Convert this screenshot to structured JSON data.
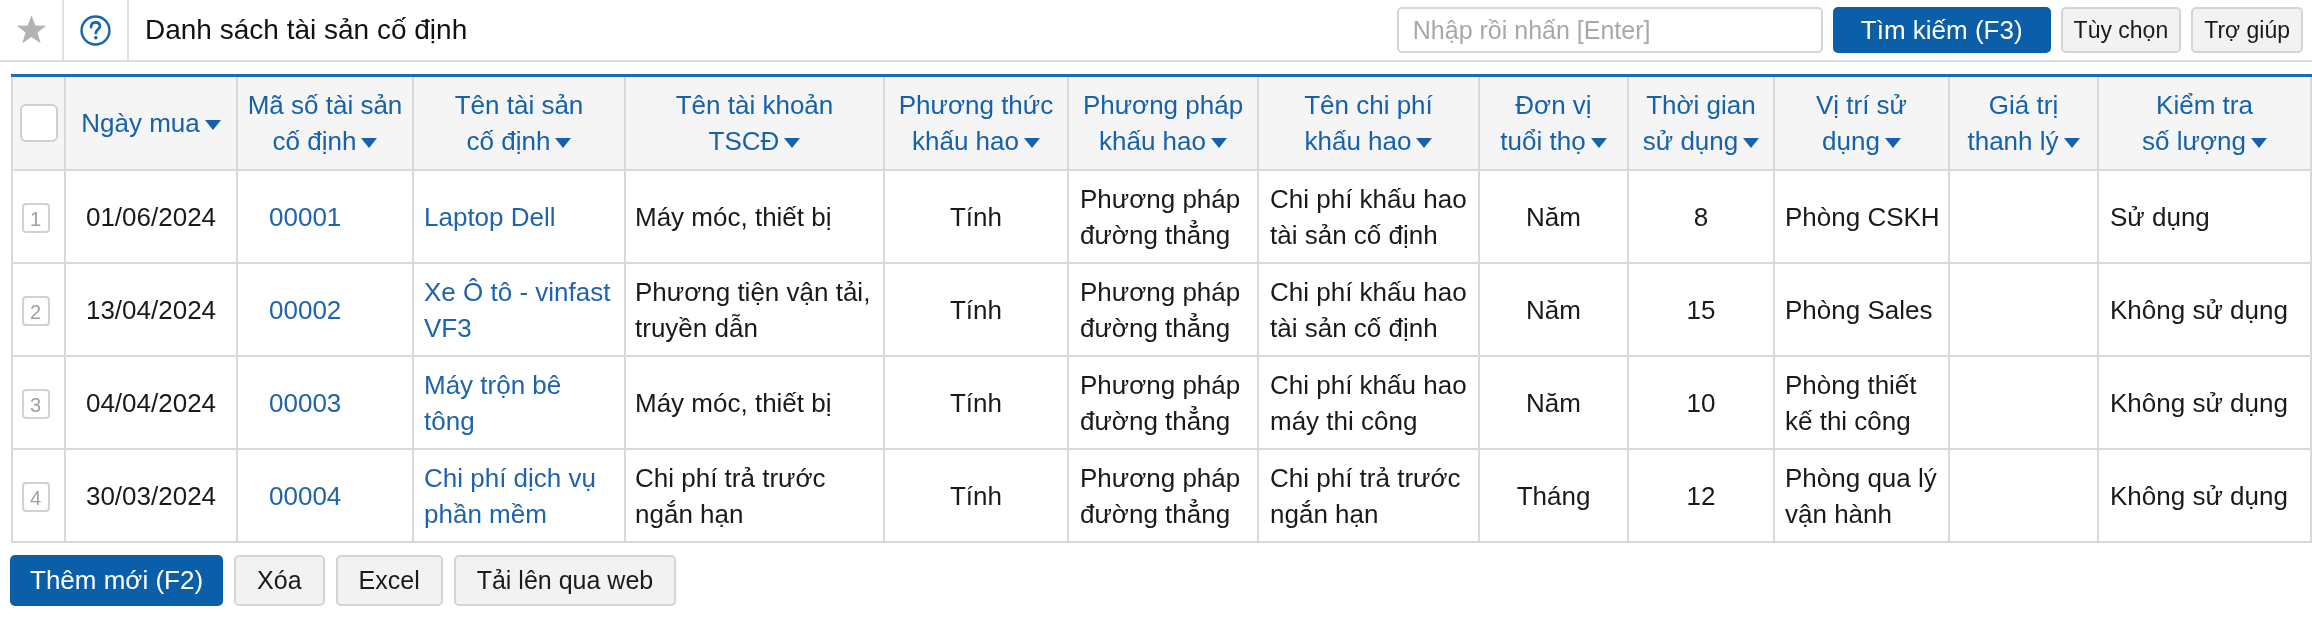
{
  "header": {
    "favorite": false,
    "title": "Danh sách tài sản cố định",
    "search": {
      "placeholder": "Nhập rồi nhấn [Enter]"
    },
    "buttons": [
      {
        "label": "Tìm kiếm (F3)",
        "kind": "primary"
      },
      {
        "label": "Tùy chọn",
        "kind": "secondary"
      },
      {
        "label": "Trợ giúp",
        "kind": "secondary"
      }
    ]
  },
  "table": {
    "select_all": {
      "checked": false
    },
    "columns": [
      {
        "label": "Ngày mua",
        "kind": "date"
      },
      {
        "label": "Mã số tài sản cố định",
        "kind": "code"
      },
      {
        "label": "Tên tài sản cố định",
        "kind": "link"
      },
      {
        "label": "Tên tài khoản TSCĐ",
        "kind": "text"
      },
      {
        "label": "Phương thức khấu hao",
        "kind": "center"
      },
      {
        "label": "Phương pháp khấu hao",
        "kind": "text"
      },
      {
        "label": "Tên chi phí khấu hao",
        "kind": "text"
      },
      {
        "label": "Đơn vị tuổi thọ",
        "kind": "center"
      },
      {
        "label": "Thời gian sử dụng",
        "kind": "center"
      },
      {
        "label": "Vị trí sử dụng",
        "kind": "text"
      },
      {
        "label": "Giá trị thanh lý"
      },
      {
        "label": "Kiểm tra số lượng",
        "kind": "text"
      }
    ],
    "rows": [
      {
        "number": "1",
        "cells": [
          "01/06/2024",
          "00001",
          "Laptop Dell",
          "Máy móc, thiết bị",
          "Tính",
          "Phương pháp đường thẳng",
          "Chi phí khấu hao tài sản cố định",
          "Năm",
          "8",
          "Phòng CSKH",
          null,
          "Sử dụng"
        ]
      },
      {
        "number": "2",
        "cells": [
          "13/04/2024",
          "00002",
          "Xe Ô tô - vinfast VF3",
          "Phương tiện vận tải, truyền dẫn",
          "Tính",
          "Phương pháp đường thẳng",
          "Chi phí khấu hao tài sản cố định",
          "Năm",
          "15",
          "Phòng Sales",
          null,
          "Không sử dụng"
        ]
      },
      {
        "number": "3",
        "cells": [
          "04/04/2024",
          "00003",
          "Máy trộn bê tông",
          "Máy móc, thiết bị",
          "Tính",
          "Phương pháp đường thẳng",
          "Chi phí khấu hao máy thi công",
          "Năm",
          "10",
          "Phòng thiết kế thi công",
          null,
          "Không sử dụng"
        ]
      },
      {
        "number": "4",
        "cells": [
          "30/03/2024",
          "00004",
          "Chi phí dịch vụ phần mềm",
          "Chi phí trả trước ngắn hạn",
          "Tính",
          "Phương pháp đường thẳng",
          "Chi phí trả trước ngắn hạn",
          "Tháng",
          "12",
          "Phòng qua lý vận hành",
          null,
          "Không sử dụng"
        ]
      }
    ]
  },
  "actions": [
    {
      "label": "Thêm mới (F2)",
      "kind": "primary"
    },
    {
      "label": "Xóa",
      "kind": "secondary"
    },
    {
      "label": "Excel",
      "kind": "secondary"
    },
    {
      "label": "Tải lên qua web",
      "kind": "secondary"
    }
  ]
}
